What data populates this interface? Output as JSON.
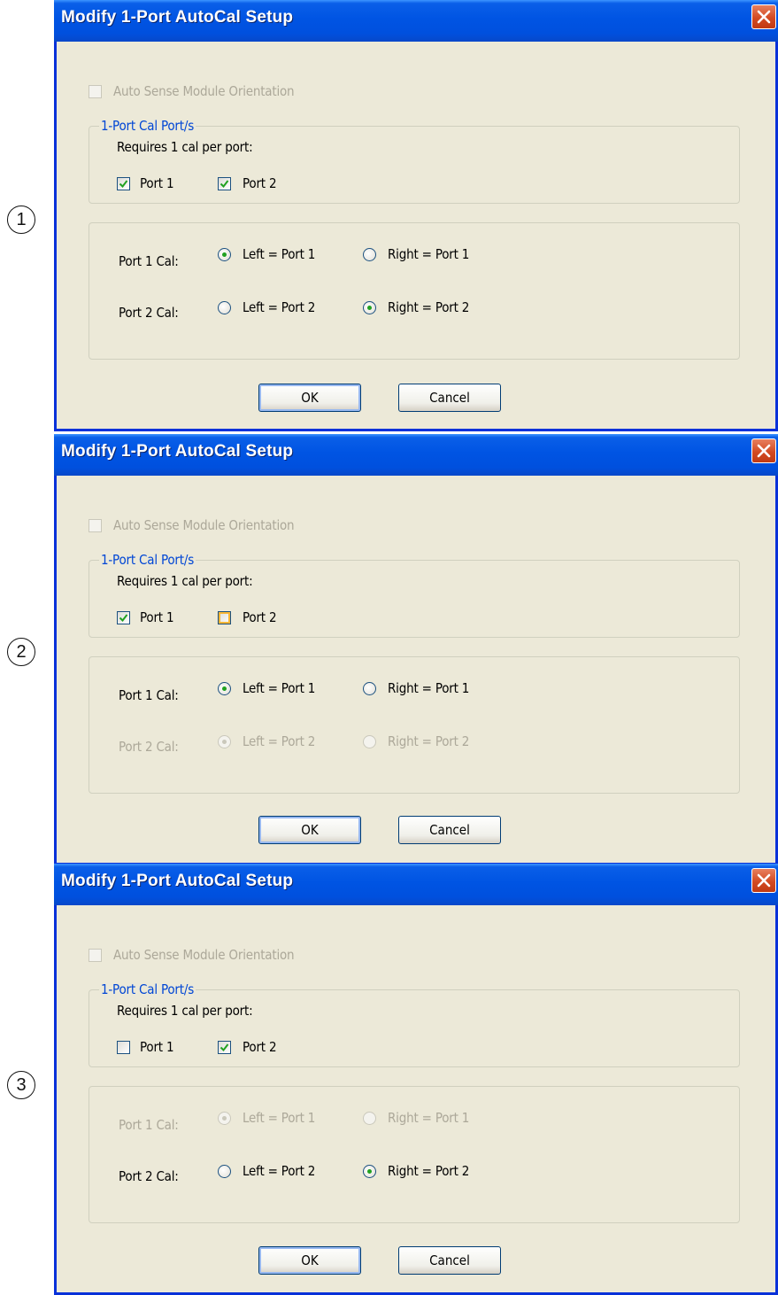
{
  "dialogs": [
    {
      "step_number": "1",
      "title": "Modify 1-Port AutoCal Setup",
      "auto_sense_label": "Auto Sense Module Orientation",
      "group_title": "1-Port Cal Port/s",
      "requires_text": "Requires 1 cal per port:",
      "port1_checkbox_label": "Port 1",
      "port2_checkbox_label": "Port 2",
      "port1_checked": true,
      "port2_checked": true,
      "port1_cal_label": "Port 1 Cal:",
      "port1_left_label": "Left = Port 1",
      "port1_right_label": "Right = Port 1",
      "port1_selected": "left",
      "port1_cal_enabled": true,
      "port2_cal_label": "Port 2 Cal:",
      "port2_left_label": "Left = Port 2",
      "port2_right_label": "Right = Port 2",
      "port2_selected": "right",
      "port2_cal_enabled": true,
      "ok_label": "OK",
      "cancel_label": "Cancel"
    },
    {
      "step_number": "2",
      "title": "Modify 1-Port AutoCal Setup",
      "auto_sense_label": "Auto Sense Module Orientation",
      "group_title": "1-Port Cal Port/s",
      "requires_text": "Requires 1 cal per port:",
      "port1_checkbox_label": "Port 1",
      "port2_checkbox_label": "Port 2",
      "port1_checked": true,
      "port2_checked": false,
      "port1_cal_label": "Port 1 Cal:",
      "port1_left_label": "Left = Port 1",
      "port1_right_label": "Right = Port 1",
      "port1_selected": "left",
      "port1_cal_enabled": true,
      "port2_cal_label": "Port 2 Cal:",
      "port2_left_label": "Left = Port 2",
      "port2_right_label": "Right = Port 2",
      "port2_selected": "left",
      "port2_cal_enabled": false,
      "ok_label": "OK",
      "cancel_label": "Cancel"
    },
    {
      "step_number": "3",
      "title": "Modify 1-Port AutoCal Setup",
      "auto_sense_label": "Auto Sense Module Orientation",
      "group_title": "1-Port Cal Port/s",
      "requires_text": "Requires 1 cal per port:",
      "port1_checkbox_label": "Port 1",
      "port2_checkbox_label": "Port 2",
      "port1_checked": false,
      "port2_checked": true,
      "port1_cal_label": "Port 1 Cal:",
      "port1_left_label": "Left = Port 1",
      "port1_right_label": "Right = Port 1",
      "port1_selected": "left",
      "port1_cal_enabled": false,
      "port2_cal_label": "Port 2 Cal:",
      "port2_left_label": "Left = Port 2",
      "port2_right_label": "Right = Port 2",
      "port2_selected": "right",
      "port2_cal_enabled": true,
      "ok_label": "OK",
      "cancel_label": "Cancel"
    }
  ],
  "colors": {
    "title_bar": "#0054e3",
    "dialog_bg": "#ece9d8",
    "group_title": "#0046d5",
    "disabled_text": "#aca899",
    "check_mark": "#21a121",
    "close_button": "#d34a22"
  },
  "icons": {
    "close": "close-x-icon",
    "check": "checkmark-icon",
    "radio_dot": "radio-dot-icon"
  }
}
